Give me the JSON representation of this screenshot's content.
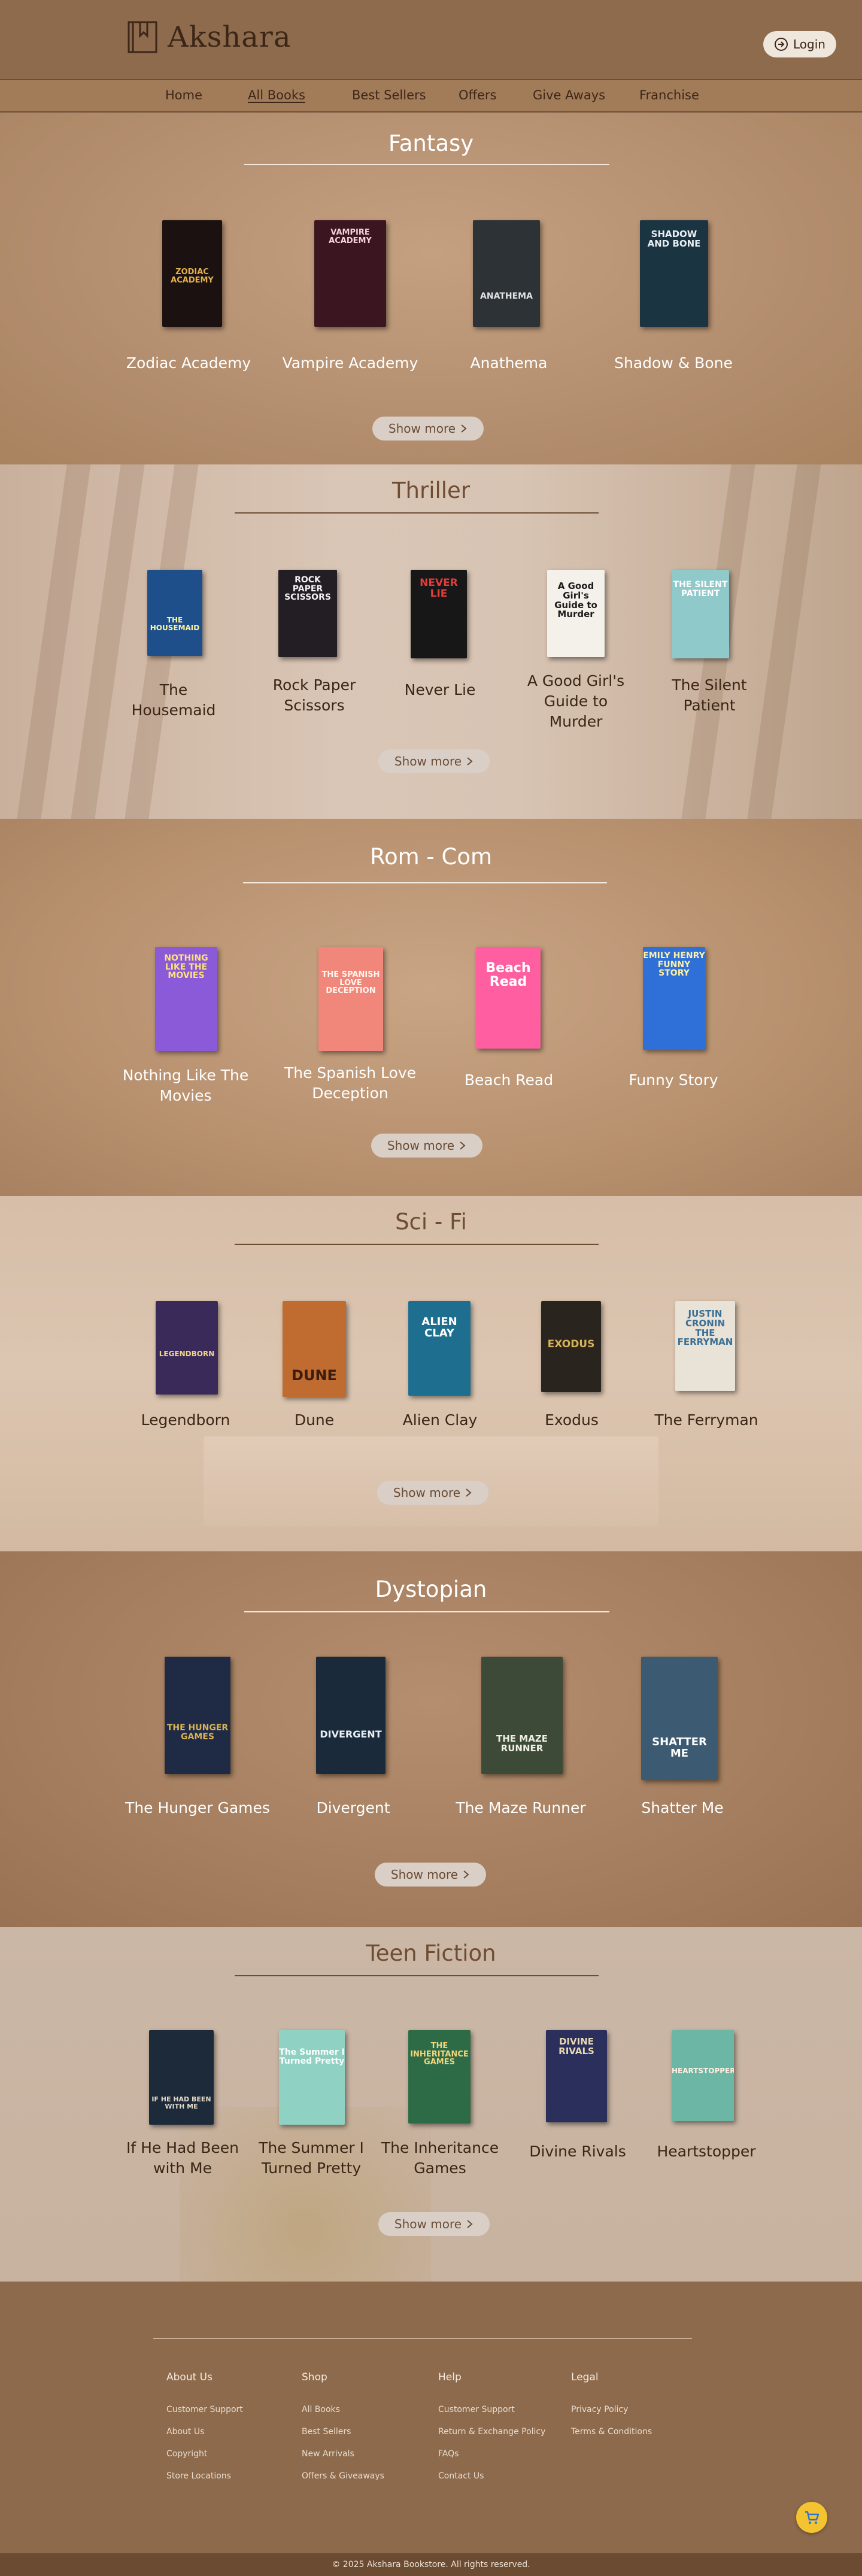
{
  "header": {
    "brand": "Akshara",
    "login_label": "Login"
  },
  "nav": {
    "items": [
      "Home",
      "All Books",
      "Best Sellers",
      "Offers",
      "Give Aways",
      "Franchise"
    ],
    "active": "All Books"
  },
  "show_more_label": "Show more",
  "sections": {
    "fantasy": {
      "title": "Fantasy",
      "books": [
        "Zodiac Academy",
        "Vampire Academy",
        "Anathema",
        "Shadow & Bone"
      ],
      "covers": [
        "ZODIAC ACADEMY",
        "VAMPIRE ACADEMY",
        "ANATHEMA",
        "SHADOW AND BONE"
      ]
    },
    "thriller": {
      "title": "Thriller",
      "books": [
        "The Housemaid",
        "Rock Paper Scissors",
        "Never Lie",
        "A Good Girl's Guide to Murder",
        "The Silent Patient"
      ],
      "covers": [
        "THE HOUSEMAID",
        "ROCK PAPER SCISSORS",
        "NEVER LIE",
        "A Good Girl's Guide to Murder",
        "THE SILENT PATIENT"
      ]
    },
    "romcom": {
      "title": "Rom - Com",
      "books": [
        "Nothing Like The Movies",
        "The Spanish Love Deception",
        "Beach Read",
        "Funny Story"
      ],
      "covers": [
        "NOTHING LIKE THE MOVIES",
        "THE SPANISH LOVE DECEPTION",
        "Beach Read",
        "EMILY HENRY FUNNY STORY"
      ]
    },
    "scifi": {
      "title": "Sci - Fi",
      "books": [
        "Legendborn",
        "Dune",
        "Alien Clay",
        "Exodus",
        "The Ferryman"
      ],
      "covers": [
        "LEGENDBORN",
        "DUNE",
        "ALIEN CLAY",
        "EXODUS",
        "JUSTIN CRONIN THE FERRYMAN"
      ]
    },
    "dystopian": {
      "title": "Dystopian",
      "books": [
        "The Hunger Games",
        "Divergent",
        "The Maze Runner",
        "Shatter Me"
      ],
      "covers": [
        "THE HUNGER GAMES",
        "DIVERGENT",
        "THE MAZE RUNNER",
        "SHATTER ME"
      ]
    },
    "teen": {
      "title": "Teen Fiction",
      "books": [
        "If He Had Been with Me",
        "The Summer I Turned Pretty",
        "The Inheritance Games",
        "Divine Rivals",
        "Heartstopper"
      ],
      "covers": [
        "IF HE HAD BEEN WITH ME",
        "The Summer I Turned Pretty",
        "THE INHERITANCE GAMES",
        "DIVINE RIVALS",
        "HEARTSTOPPER"
      ]
    }
  },
  "footer": {
    "columns": [
      {
        "heading": "About Us",
        "links": [
          "Customer Support",
          "About Us",
          "Copyright",
          "Store Locations"
        ]
      },
      {
        "heading": "Shop",
        "links": [
          "All Books",
          "Best Sellers",
          "New Arrivals",
          "Offers & Giveaways"
        ]
      },
      {
        "heading": "Help",
        "links": [
          "Customer Support",
          "Return & Exchange Policy",
          "FAQs",
          "Contact Us"
        ]
      },
      {
        "heading": "Legal",
        "links": [
          "Privacy Policy",
          "Terms & Conditions"
        ]
      }
    ],
    "copyright": "© 2025 Akshara Bookstore. All rights reserved."
  },
  "colors": {
    "header_bg": "#8e6b4d",
    "brand_text": "#3c2617",
    "button_bg": "#d9cfc6",
    "cart_bg": "#f4c430"
  },
  "icons": [
    "book-logo-icon",
    "login-icon",
    "chevron-right-icon",
    "cart-icon"
  ]
}
